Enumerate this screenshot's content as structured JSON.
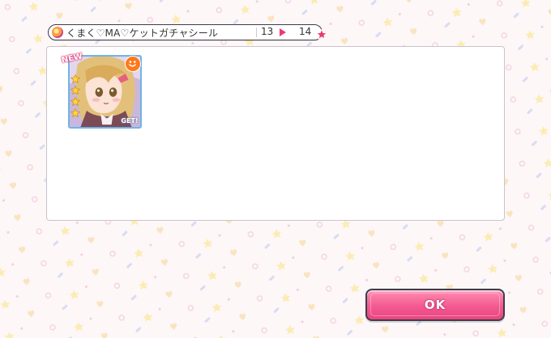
{
  "item_bar": {
    "icon": "gacha-sticker-icon",
    "name": "くまく♡MA♡ケットガチャシール",
    "count_before": "13",
    "count_after": "14"
  },
  "card": {
    "new_label": "NEW",
    "rarity_stars": 4,
    "attribute_icon": "happy-attribute-icon",
    "get_label": "GET!"
  },
  "ok_button": {
    "label": "OK"
  },
  "colors": {
    "accent_pink": "#f35a8f",
    "arrow_pink": "#ea3a73",
    "card_frame": "#6fb3e8",
    "attribute_orange": "#ff7a1a"
  }
}
